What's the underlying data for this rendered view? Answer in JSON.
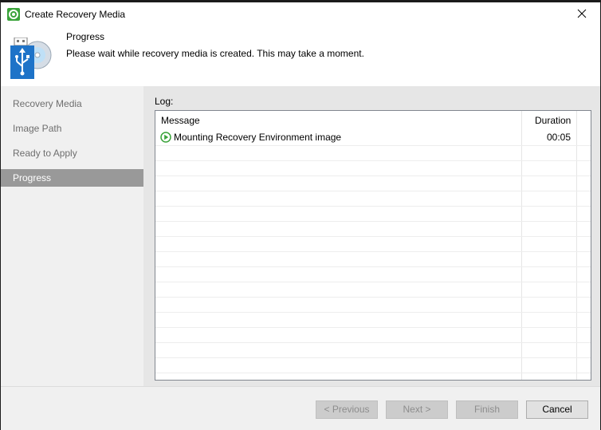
{
  "window": {
    "title": "Create Recovery Media",
    "close_icon": "close-icon"
  },
  "header": {
    "title": "Progress",
    "description": "Please wait while recovery media is created. This may take a moment.",
    "icon": "usb-recovery-icon"
  },
  "sidebar": {
    "items": [
      {
        "label": "Recovery Media",
        "active": false
      },
      {
        "label": "Image Path",
        "active": false
      },
      {
        "label": "Ready to Apply",
        "active": false
      },
      {
        "label": "Progress",
        "active": true
      }
    ]
  },
  "log": {
    "label": "Log:",
    "columns": {
      "message": "Message",
      "duration": "Duration"
    },
    "rows": [
      {
        "status_icon": "play-status-icon",
        "message": "Mounting Recovery Environment image",
        "duration": "00:05"
      }
    ]
  },
  "buttons": {
    "previous": "< Previous",
    "next": "Next >",
    "finish": "Finish",
    "cancel": "Cancel"
  },
  "colors": {
    "accent_green": "#3aa33a",
    "active_step_bg": "#999999",
    "usb_blue": "#1e73c8"
  }
}
